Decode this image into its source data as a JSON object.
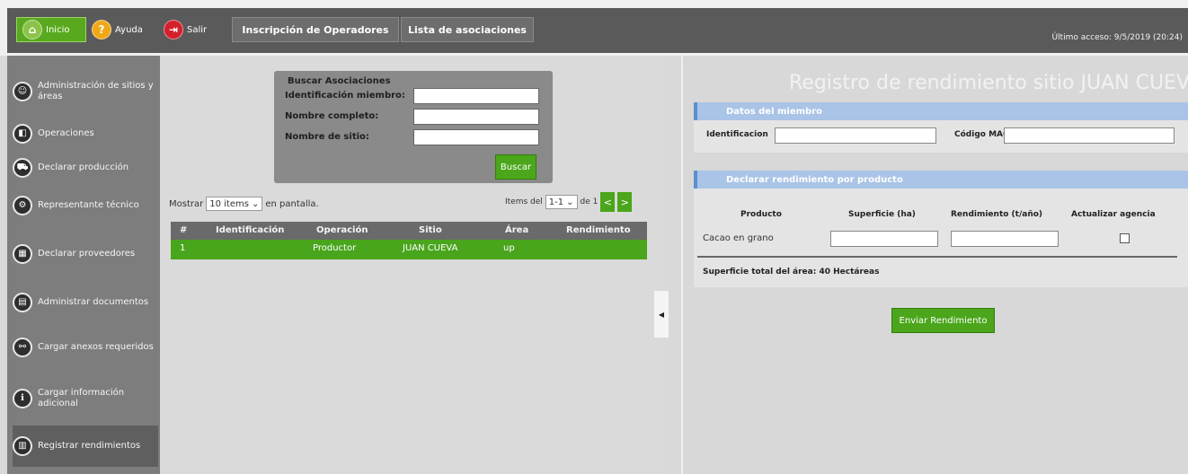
{
  "topbar": {
    "home_label": "Inicio",
    "help_label": "Ayuda",
    "exit_label": "Salir",
    "tab_inscription": "Inscripción de Operadores",
    "tab_associations": "Lista de asociaciones",
    "last_access": "Último acceso: 9/5/2019 (20:24)"
  },
  "sidebar": {
    "items": [
      {
        "label": "Administración de sitios y áreas",
        "icon": "people-icon"
      },
      {
        "label": "Operaciones",
        "icon": "door-icon"
      },
      {
        "label": "Declarar producción",
        "icon": "cart-icon"
      },
      {
        "label": "Representante técnico",
        "icon": "technician-icon"
      },
      {
        "label": "Declarar proveedores",
        "icon": "supplier-icon"
      },
      {
        "label": "Administrar documentos",
        "icon": "document-icon"
      },
      {
        "label": "Cargar anexos requeridos",
        "icon": "attachment-icon"
      },
      {
        "label": "Cargar información adicional",
        "icon": "info-icon"
      },
      {
        "label": "Registrar rendimientos",
        "icon": "chart-icon"
      }
    ]
  },
  "search": {
    "title": "Buscar Asociaciones",
    "id_label": "Identificación miembro:",
    "name_label": "Nombre completo:",
    "site_label": "Nombre de sitio:",
    "button": "Buscar"
  },
  "list": {
    "show_prefix": "Mostrar",
    "page_size": "10 items",
    "show_suffix": "en pantalla.",
    "items_prefix": "Items del",
    "range": "1-1",
    "of_label": "de 1",
    "prev": "<",
    "next": ">"
  },
  "table": {
    "headers": [
      "#",
      "Identificación",
      "Operación",
      "Sitio",
      "Área",
      "Rendimiento"
    ],
    "rows": [
      [
        "1",
        "",
        "Productor",
        "JUAN CUEVA",
        "up",
        ""
      ]
    ]
  },
  "right": {
    "title": "Registro de rendimiento sitio JUAN CUEVA",
    "member_section": "Datos del miembro",
    "id_label": "Identificacion",
    "mag_label": "Código MAG",
    "yield_section": "Declarar rendimiento por producto",
    "headers": [
      "Producto",
      "Superficie (ha)",
      "Rendimiento (t/año)",
      "Actualizar agencia"
    ],
    "product": "Cacao en grano",
    "total_area": "Superficie total del área: 40 Hectáreas",
    "send_button": "Enviar Rendimiento"
  },
  "colors": {
    "green": "#4ba61b",
    "section_blue": "#a9c4e6",
    "dark_bar": "#5a5a5a"
  }
}
